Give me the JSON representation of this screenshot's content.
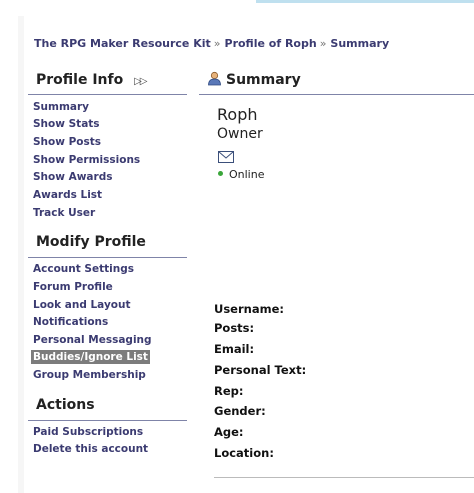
{
  "breadcrumb": [
    {
      "label": "The RPG Maker Resource Kit"
    },
    {
      "label": "Profile of Roph"
    },
    {
      "label": "Summary"
    }
  ],
  "breadcrumb_separator": "»",
  "sidebar": {
    "profile_info": {
      "title": "Profile Info",
      "toggle_icon": "double-arrow-icon",
      "items": [
        {
          "label": "Summary"
        },
        {
          "label": "Show Stats"
        },
        {
          "label": "Show Posts"
        },
        {
          "label": "Show Permissions"
        },
        {
          "label": "Show Awards"
        },
        {
          "label": "Awards List"
        },
        {
          "label": "Track User"
        }
      ]
    },
    "modify_profile": {
      "title": "Modify Profile",
      "items": [
        {
          "label": "Account Settings"
        },
        {
          "label": "Forum Profile"
        },
        {
          "label": "Look and Layout"
        },
        {
          "label": "Notifications"
        },
        {
          "label": "Personal Messaging"
        },
        {
          "label": "Buddies/Ignore List"
        },
        {
          "label": "Group Membership"
        }
      ]
    },
    "actions": {
      "title": "Actions",
      "items": [
        {
          "label": "Paid Subscriptions"
        },
        {
          "label": "Delete this account"
        }
      ]
    }
  },
  "main": {
    "title": "Summary",
    "title_icon": "user-icon",
    "user_name": "Roph",
    "user_role": "Owner",
    "email_icon": "envelope-icon",
    "status": "Online",
    "fields": [
      {
        "label": "Username:"
      },
      {
        "label": "Posts:"
      },
      {
        "label": "Email:"
      },
      {
        "label": "Personal Text:"
      },
      {
        "label": "Rep:"
      },
      {
        "label": "Gender:"
      },
      {
        "label": "Age:"
      },
      {
        "label": "Location:"
      }
    ]
  },
  "colors": {
    "link": "#3b3b71",
    "divider": "#7f84a8",
    "active_bg": "#7c7c7c",
    "online": "#3aa63a",
    "topbar": "#bfe0ef"
  }
}
